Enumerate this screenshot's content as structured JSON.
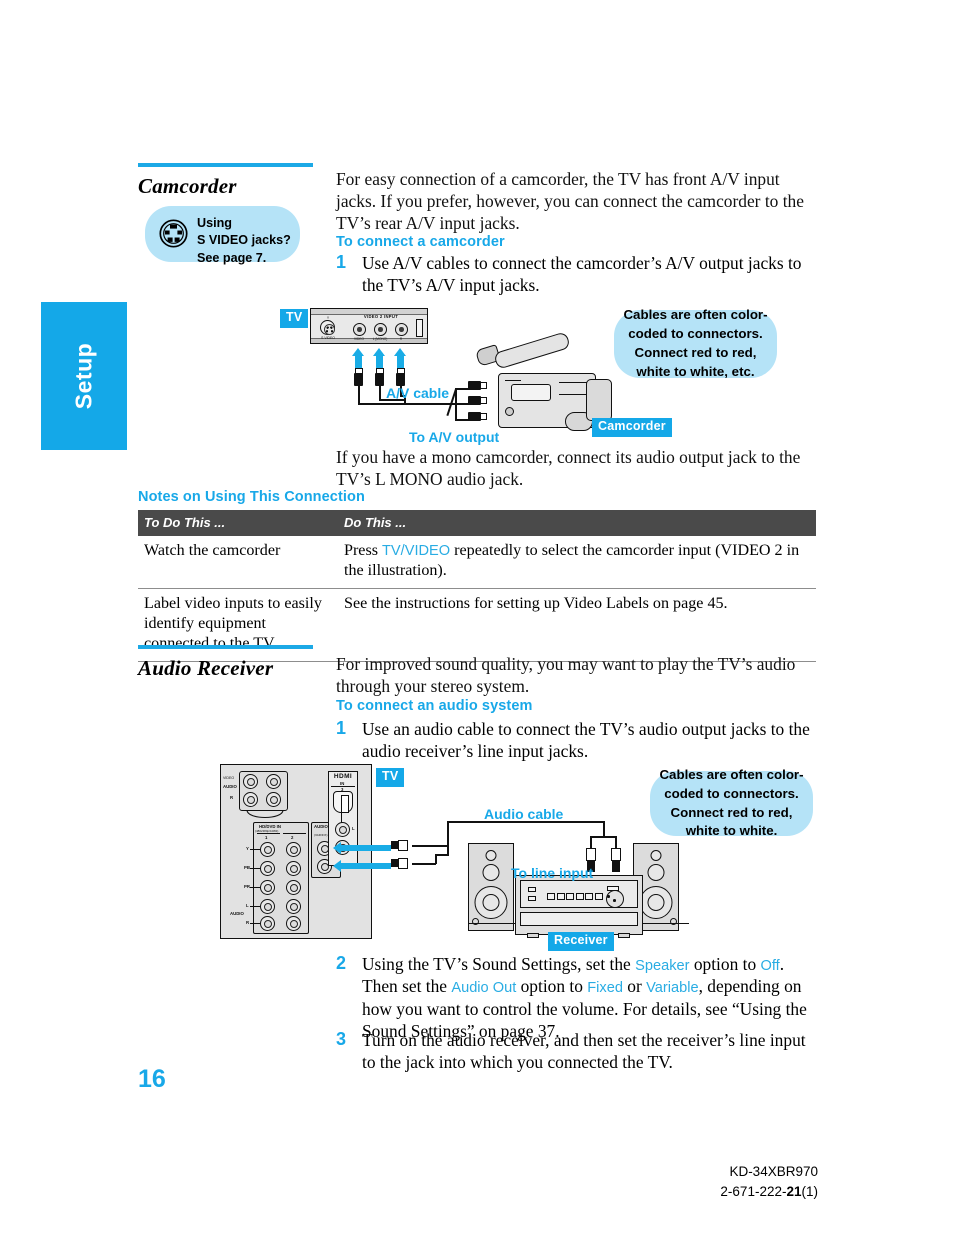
{
  "side_tab": {
    "label": "Setup"
  },
  "sections": [
    {
      "id": "camcorder",
      "title": "Camcorder",
      "callout": {
        "icon": "s-video-jack-icon",
        "lines": [
          "Using",
          "S VIDEO jacks?",
          "See page 7."
        ]
      },
      "intro": "For easy connection of a camcorder, the TV has front A/V input jacks. If you prefer, however, you can connect the camcorder to the TV’s rear A/V input jacks.",
      "sub_head": "To connect a camcorder",
      "steps": [
        {
          "num": "1",
          "text": "Use A/V cables to connect the camcorder’s A/V output jacks to the TV’s A/V input jacks."
        }
      ],
      "after_text": "If you have a mono camcorder, connect its audio output jack to the TV’s L MONO audio jack.",
      "diagram": {
        "tv_chip": "TV",
        "device_chip": "Camcorder",
        "cable_label": "A/V cable",
        "output_label": "To A/V output",
        "panel_caption": "VIDEO 2 INPUT",
        "panel_svideo_label": "S VIDEO",
        "panel_svideo_top": "Y",
        "panel_jack_labels": [
          "VIDEO",
          "L (MONO)",
          "R"
        ],
        "bubble": "Cables are often color-coded to connectors. Connect red to red, white to white, etc."
      }
    },
    {
      "id": "audio-receiver",
      "title": "Audio Receiver",
      "intro": "For improved sound quality, you may want to play the TV’s audio through your stereo system.",
      "sub_head": "To connect an audio system",
      "steps": [
        {
          "num": "1",
          "text": "Use an audio cable to connect the TV’s audio output jacks to the audio receiver’s line input jacks."
        },
        {
          "num": "2",
          "text_parts": [
            "Using the TV’s Sound Settings, set the ",
            "Speaker",
            " option to ",
            "Off",
            ". Then set the ",
            "Audio Out",
            " option to ",
            "Fixed",
            " or ",
            "Variable",
            ", depending on how you want to control the volume. For details, see “Using the Sound Settings” on page 37."
          ]
        },
        {
          "num": "3",
          "text": "Turn on the audio receiver, and then set the receiver’s line input to the jack into which you connected the TV."
        }
      ],
      "diagram": {
        "tv_chip": "TV",
        "device_chip": "Receiver",
        "cable_label": "Audio cable",
        "line_input_label": "To line input",
        "panel_labels": {
          "video": "VIDEO",
          "audio": "AUDIO",
          "r": "R",
          "hd_dvd_in": "HD/DVD IN",
          "hd_dvd_sub": "(480i/480p/1080i)",
          "port_1": "1",
          "port_2": "2",
          "y": "Y",
          "pb": "PB",
          "pr": "PR",
          "l": "L",
          "audio2": "AUDIO",
          "r2": "R",
          "audio_out": "AUDIO OUT",
          "audio_out_sub": "(VAR/FIX)",
          "hdmi": "HDMI",
          "hdmi_in": "IN",
          "hdmi_num": "3",
          "hdmi_l": "L",
          "hdmi_r": "R"
        },
        "bubble": "Cables are often color-coded to connectors. Connect red to red, white to white."
      }
    }
  ],
  "notes": {
    "heading": "Notes on Using This Connection",
    "columns": [
      "To Do This ...",
      "Do This ..."
    ],
    "rows": [
      {
        "do_this": "Watch the camcorder",
        "action_parts": [
          "Press ",
          "TV/VIDEO",
          " repeatedly to select the camcorder input (VIDEO 2 in the illustration)."
        ]
      },
      {
        "do_this": "Label video inputs to easily identify equipment connected to the TV",
        "action_parts": [
          "See the instructions for setting up Video Labels on page 45.",
          "",
          ""
        ]
      }
    ]
  },
  "footer": {
    "page_number": "16",
    "model": "KD-34XBR970",
    "doc_code_pre": "2-671-222-",
    "doc_code_bold": "21",
    "doc_code_post": "(1)"
  },
  "colors": {
    "accent_blue": "#14A8E8",
    "light_blue": "#B5E3F7",
    "table_header": "#4A4A4A"
  }
}
